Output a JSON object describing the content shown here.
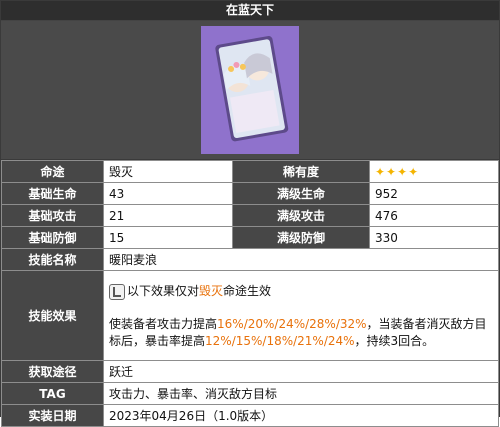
{
  "title": "在蓝天下",
  "image": {
    "icon": "card-illustration"
  },
  "rows": {
    "path": {
      "label": "命途",
      "value": "毁灭"
    },
    "rarity": {
      "label": "稀有度",
      "stars": "✦✦✦✦"
    },
    "hp": {
      "label": "基础生命",
      "value": "43",
      "max_label": "满级生命",
      "max_value": "952"
    },
    "atk": {
      "label": "基础攻击",
      "value": "21",
      "max_label": "满级攻击",
      "max_value": "476"
    },
    "def": {
      "label": "基础防御",
      "value": "15",
      "max_label": "满级防御",
      "max_value": "330"
    },
    "skill_name": {
      "label": "技能名称",
      "value": "暖阳麦浪"
    },
    "skill_effect": {
      "label": "技能效果",
      "cond_pre": "以下效果仅对",
      "cond_hl": "毁灭",
      "cond_post": "命途生效",
      "line1_pre": "使装备者攻击力提高",
      "line1_hl": "16%/20%/24%/28%/32%",
      "line1_post": "，当装备者消灭敌方目标后，暴击率提高",
      "line2_hl": "12%/15%/18%/21%/24%",
      "line2_post": "，持续3回合。"
    },
    "obtain": {
      "label": "获取途径",
      "value": "跃迁"
    },
    "tag": {
      "label": "TAG",
      "value": "攻击力、暴击率、消灭敌方目标"
    },
    "date": {
      "label": "实装日期",
      "value": "2023年04月26日（1.0版本）"
    }
  }
}
